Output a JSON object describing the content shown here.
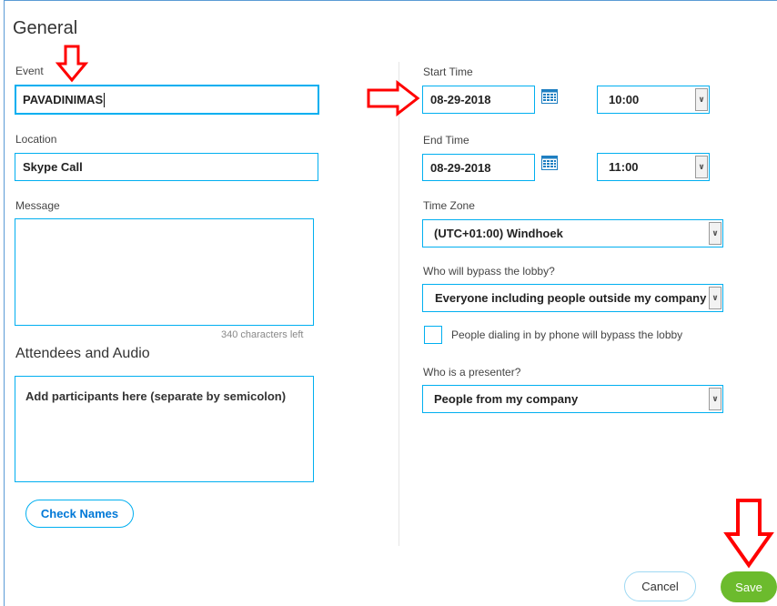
{
  "form": {
    "title": "General",
    "event": {
      "label": "Event",
      "value": "PAVADINIMAS"
    },
    "location": {
      "label": "Location",
      "value": "Skype Call"
    },
    "message": {
      "label": "Message",
      "value": "",
      "chars_left": "340 characters left"
    },
    "attendees": {
      "heading": "Attendees and Audio",
      "placeholder": "Add participants here (separate by semicolon)",
      "check_names_label": "Check Names"
    },
    "start_time": {
      "label": "Start Time",
      "date": "08-29-2018",
      "time": "10:00"
    },
    "end_time": {
      "label": "End Time",
      "date": "08-29-2018",
      "time": "11:00"
    },
    "time_zone": {
      "label": "Time Zone",
      "value": "(UTC+01:00) Windhoek"
    },
    "lobby": {
      "label": "Who will bypass the lobby?",
      "value": "Everyone including people outside my company"
    },
    "phone_bypass": {
      "label": "People dialing in by phone will bypass the lobby",
      "checked": false
    },
    "presenter": {
      "label": "Who is a presenter?",
      "value": "People from my company"
    }
  },
  "footer": {
    "cancel_label": "Cancel",
    "save_label": "Save"
  },
  "colors": {
    "accent": "#00aff0",
    "save_green": "#6cbb2d",
    "annotation_red": "#ff0000"
  }
}
